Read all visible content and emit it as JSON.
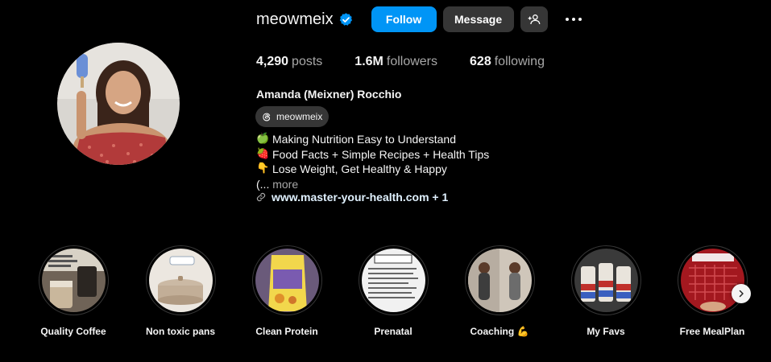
{
  "profile": {
    "username": "meowmeix",
    "verified_icon": "verified-badge-icon",
    "follow_label": "Follow",
    "message_label": "Message",
    "add_user_icon": "add-user-icon",
    "more_icon": "more-options-icon",
    "full_name": "Amanda (Meixner) Rocchio",
    "threads_handle": "meowmeix"
  },
  "stats": {
    "posts_count": "4,290",
    "posts_label": "posts",
    "followers_count": "1.6M",
    "followers_label": "followers",
    "following_count": "628",
    "following_label": "following"
  },
  "bio": {
    "lines": [
      {
        "emoji": "🍏",
        "text": "Making Nutrition Easy to Understand"
      },
      {
        "emoji": "🍓",
        "text": "Food Facts + Simple Recipes + Health Tips"
      },
      {
        "emoji": "👇",
        "text": "Lose Weight, Get Healthy & Happy"
      }
    ],
    "more_prefix": "(...",
    "more_label": "more",
    "link_text": "www.master-your-health.com + 1"
  },
  "highlights": [
    {
      "label": "Quality Coffee"
    },
    {
      "label": "Non toxic pans"
    },
    {
      "label": "Clean Protein"
    },
    {
      "label": "Prenatal"
    },
    {
      "label": "Coaching 💪"
    },
    {
      "label": "My Favs"
    },
    {
      "label": "Free MealPlan"
    }
  ],
  "colors": {
    "background": "#000000",
    "primary_button": "#0095f6",
    "secondary_button": "#363636",
    "verified": "#0095f6",
    "muted_text": "#a8a8a8",
    "link_text": "#e0f1ff"
  }
}
